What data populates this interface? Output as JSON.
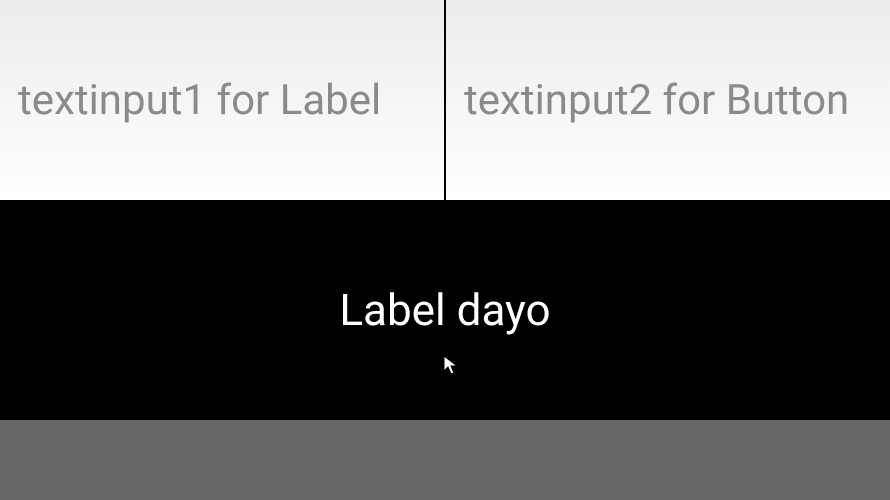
{
  "inputs": {
    "left": {
      "value": "",
      "placeholder": "textinput1 for Label"
    },
    "right": {
      "value": "",
      "placeholder": "textinput2 for Button"
    }
  },
  "label": {
    "text": "Label dayo"
  }
}
